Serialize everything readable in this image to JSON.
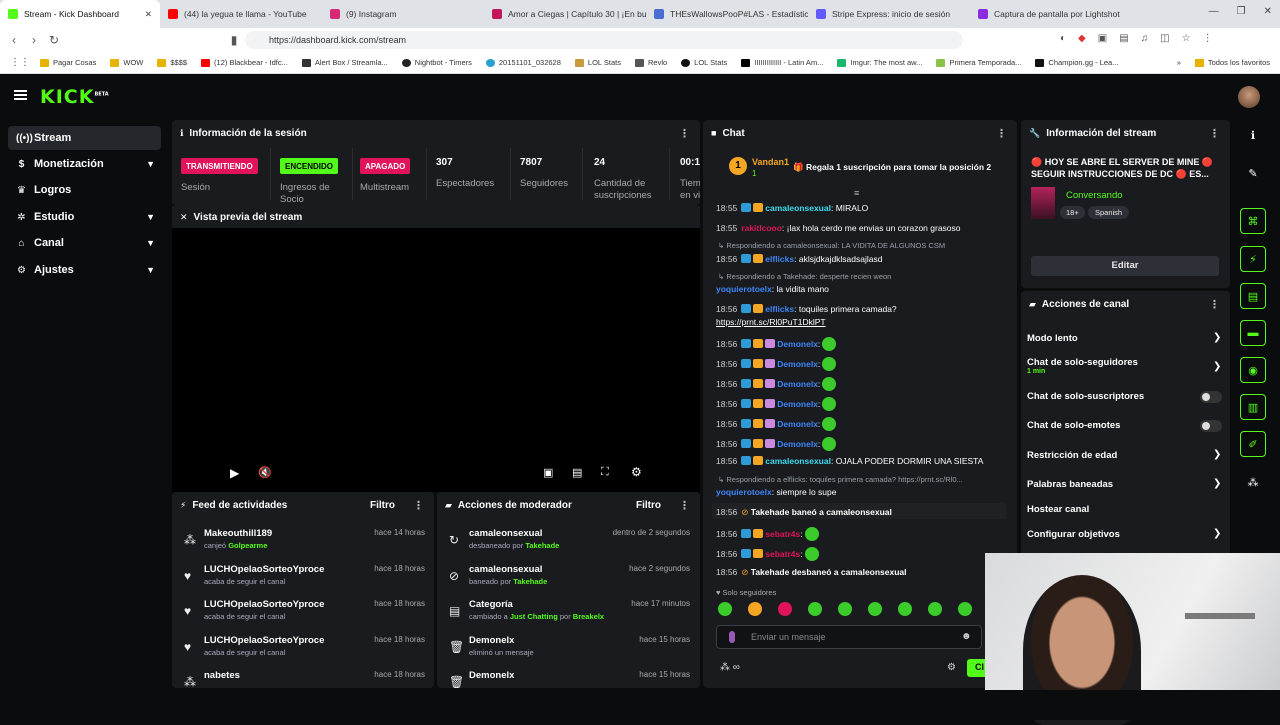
{
  "browser": {
    "tabs": [
      {
        "title": "Stream - Kick Dashboard",
        "color": "#53fc18",
        "active": true
      },
      {
        "title": "(44) la yegua te llama - YouTube",
        "color": "#ff0000"
      },
      {
        "title": "(9) Instagram",
        "color": "#d62976"
      },
      {
        "title": "Amor a Ciegas | Capítulo 30 | ¡En bu...",
        "color": "#c2185b"
      },
      {
        "title": "THEsWallowsPooP#LAS - Estadística...",
        "color": "#4a6cd4"
      },
      {
        "title": "Stripe Express: inicio de sesión",
        "color": "#635bff"
      },
      {
        "title": "Captura de pantalla por Lightshot",
        "color": "#8a2be2"
      }
    ],
    "url": "https://dashboard.kick.com/stream",
    "bookmarks": [
      "Pagar Cosas",
      "WOW",
      "$$$$",
      "(12) Blackbear - Idfc...",
      "Alert Box / Streamla...",
      "Nightbot - Timers",
      "20151101_032628",
      "LOL Stats",
      "Revlo",
      "LOL Stats",
      "IIIIIIIIIIIII - Latin Am...",
      "Imgur: The most aw...",
      "Primera Temporada...",
      "Champion.gg - Lea..."
    ],
    "bookmarks_all": "Todos los favoritos"
  },
  "app": {
    "logo": "KICK",
    "logo_sup": "BETA",
    "sidebar": [
      {
        "label": "Stream",
        "icon": "stream-icon",
        "active": true
      },
      {
        "label": "Monetización",
        "icon": "dollar-icon",
        "chevron": true
      },
      {
        "label": "Logros",
        "icon": "trophy-icon"
      },
      {
        "label": "Estudio",
        "icon": "studio-icon",
        "chevron": true
      },
      {
        "label": "Canal",
        "icon": "home-icon",
        "chevron": true
      },
      {
        "label": "Ajustes",
        "icon": "gear-icon",
        "chevron": true
      }
    ]
  },
  "session": {
    "title": "Información de la sesión",
    "badges": [
      {
        "text": "TRANSMITIENDO",
        "label": "Sesión",
        "bg": "#e0135b",
        "fg": "#fff"
      },
      {
        "text": "ENCENDIDO",
        "label": "Ingresos de Socio",
        "bg": "#53fc18",
        "fg": "#000"
      },
      {
        "text": "APAGADO",
        "label": "Multistream",
        "bg": "#e0135b",
        "fg": "#fff"
      }
    ],
    "stats": [
      {
        "value": "307",
        "label": "Espectadores"
      },
      {
        "value": "7807",
        "label": "Seguidores"
      },
      {
        "value": "24",
        "label": "Cantidad de suscripciones"
      },
      {
        "value": "00:1",
        "label": "Tiem en vi"
      }
    ]
  },
  "preview": {
    "title": "Vista previa del stream"
  },
  "feed": {
    "title": "Feed de actividades",
    "filter": "Filtro",
    "items": [
      {
        "name": "Makeouthill189",
        "sub_pre": "canjeó ",
        "sub_hl": "Golpearme",
        "time": "hace 14 horas",
        "icon": "redeem-icon"
      },
      {
        "name": "LUCHOpelaoSorteoYproce",
        "sub_pre": "acaba de seguir el canal",
        "sub_hl": "",
        "time": "hace 18 horas",
        "icon": "heart-icon"
      },
      {
        "name": "LUCHOpelaoSorteoYproce",
        "sub_pre": "acaba de seguir el canal",
        "sub_hl": "",
        "time": "hace 18 horas",
        "icon": "heart-icon"
      },
      {
        "name": "LUCHOpelaoSorteoYproce",
        "sub_pre": "acaba de seguir el canal",
        "sub_hl": "",
        "time": "hace 18 horas",
        "icon": "heart-icon"
      },
      {
        "name": "nabetes",
        "sub_pre": "",
        "sub_hl": "",
        "time": "hace 18 horas",
        "icon": "redeem-icon"
      }
    ]
  },
  "modactions": {
    "title": "Acciones de moderador",
    "filter": "Filtro",
    "items": [
      {
        "name": "camaleonsexual",
        "sub_pre": "desbaneado por ",
        "sub_hl": "Takehade",
        "time": "dentro de 2 segundos",
        "icon": "unban-icon"
      },
      {
        "name": "camaleonsexual",
        "sub_pre": "baneado por ",
        "sub_hl": "Takehade",
        "time": "hace 2 segundos",
        "icon": "ban-icon"
      },
      {
        "name": "Categoría",
        "sub_pre": "cambiado a ",
        "sub_hl": "Just Chatting",
        "sub_post": " por ",
        "sub_hl2": "Breakelx",
        "time": "hace 17 minutos",
        "icon": "category-icon"
      },
      {
        "name": "Demonelx",
        "sub_pre": "eliminó un mensaje",
        "sub_hl": "",
        "time": "hace 15 horas",
        "icon": "trash-icon"
      },
      {
        "name": "Demonelx",
        "sub_pre": "",
        "sub_hl": "",
        "time": "hace 15 horas",
        "icon": "trash-icon"
      }
    ]
  },
  "chat": {
    "title": "Chat",
    "pinned_user": "Vandan1",
    "pinned_count": "1",
    "pinned_text": "Regala 1 suscripción para tomar la posición 2",
    "messages": [
      {
        "ts": "18:55",
        "user": "camaleonsexual",
        "color": "#3ddcf0",
        "text": "MIRALO"
      },
      {
        "ts": "18:55",
        "user": "rakitlcooo",
        "color": "#e0135b",
        "text": "¡lax hola cerdo me envias un corazon grasoso"
      },
      {
        "reply": "Respondiendo a camaleonsexual: LA VIDITA DE ALGUNOS CSM"
      },
      {
        "ts": "18:56",
        "user": "elflicks",
        "color": "#3d86f5",
        "text": "aklsjdkajdklsadsajlasd"
      },
      {
        "reply": "Respondiendo a Takehade: desperte recien weon"
      },
      {
        "ts": "",
        "user": "yoquierotoelx",
        "color": "#3d86f5",
        "text": "la vidita mano"
      },
      {
        "ts": "18:56",
        "user": "elflicks",
        "color": "#3d86f5",
        "text": "toquiles primera camada?"
      },
      {
        "link": "https://prnt.sc/Rl0PuT1DklPT"
      },
      {
        "ts": "18:56",
        "user": "Demonelx",
        "color": "#3d86f5",
        "text": ""
      },
      {
        "ts": "18:56",
        "user": "Demonelx",
        "color": "#3d86f5",
        "text": ""
      },
      {
        "ts": "18:56",
        "user": "Demonelx",
        "color": "#3d86f5",
        "text": ""
      },
      {
        "ts": "18:56",
        "user": "Demonelx",
        "color": "#3d86f5",
        "text": ""
      },
      {
        "ts": "18:56",
        "user": "Demonelx",
        "color": "#3d86f5",
        "text": ""
      },
      {
        "ts": "18:56",
        "user": "Demonelx",
        "color": "#3d86f5",
        "text": ""
      },
      {
        "ts": "18:56",
        "user": "camaleonsexual",
        "color": "#3ddcf0",
        "text": "OJALA PODER DORMIR UNA SIESTA"
      },
      {
        "reply": "Respondiendo a elflicks: toquiles primera camada? https://prnt.sc/Rl0..."
      },
      {
        "ts": "",
        "user": "yoquierotoelx",
        "color": "#3d86f5",
        "text": "siempre lo supe"
      },
      {
        "sys": "Takehade baneó a camaleonsexual",
        "ts": "18:56"
      },
      {
        "ts": "18:56",
        "user": "sebatr4s",
        "color": "#e0135b",
        "text": ""
      },
      {
        "ts": "18:56",
        "user": "sebatr4s",
        "color": "#e0135b",
        "text": ""
      },
      {
        "sys": "Takehade desbaneó a camaleonsexual",
        "ts": "18:56"
      }
    ],
    "followers_only": "Solo seguidores",
    "placeholder": "Enviar un mensaje",
    "send": "Cl"
  },
  "streaminfo": {
    "title": "Información del stream",
    "stream_title": "🔴 HOY SE ABRE EL SERVER DE MINE 🔴 SEGUIR INSTRUCCIONES DE DC 🔴 ES...",
    "category": "Conversando",
    "tags": [
      "18+",
      "Spanish"
    ],
    "edit": "Editar"
  },
  "channelactions": {
    "title": "Acciones de canal",
    "items": [
      {
        "label": "Modo lento",
        "type": "chevron"
      },
      {
        "label": "Chat de solo-seguidores",
        "sub": "1 min",
        "type": "chevron"
      },
      {
        "label": "Chat de solo-suscriptores",
        "type": "toggle"
      },
      {
        "label": "Chat de solo-emotes",
        "type": "toggle"
      },
      {
        "label": "Restricción de edad",
        "type": "chevron"
      },
      {
        "label": "Palabras baneadas",
        "type": "chevron"
      },
      {
        "label": "Hostear canal",
        "type": "none"
      },
      {
        "label": "Configurar objetivos",
        "type": "chevron"
      }
    ]
  },
  "colors": {
    "accent": "#53fc18",
    "live": "#e0135b",
    "panel": "#191b1f"
  }
}
